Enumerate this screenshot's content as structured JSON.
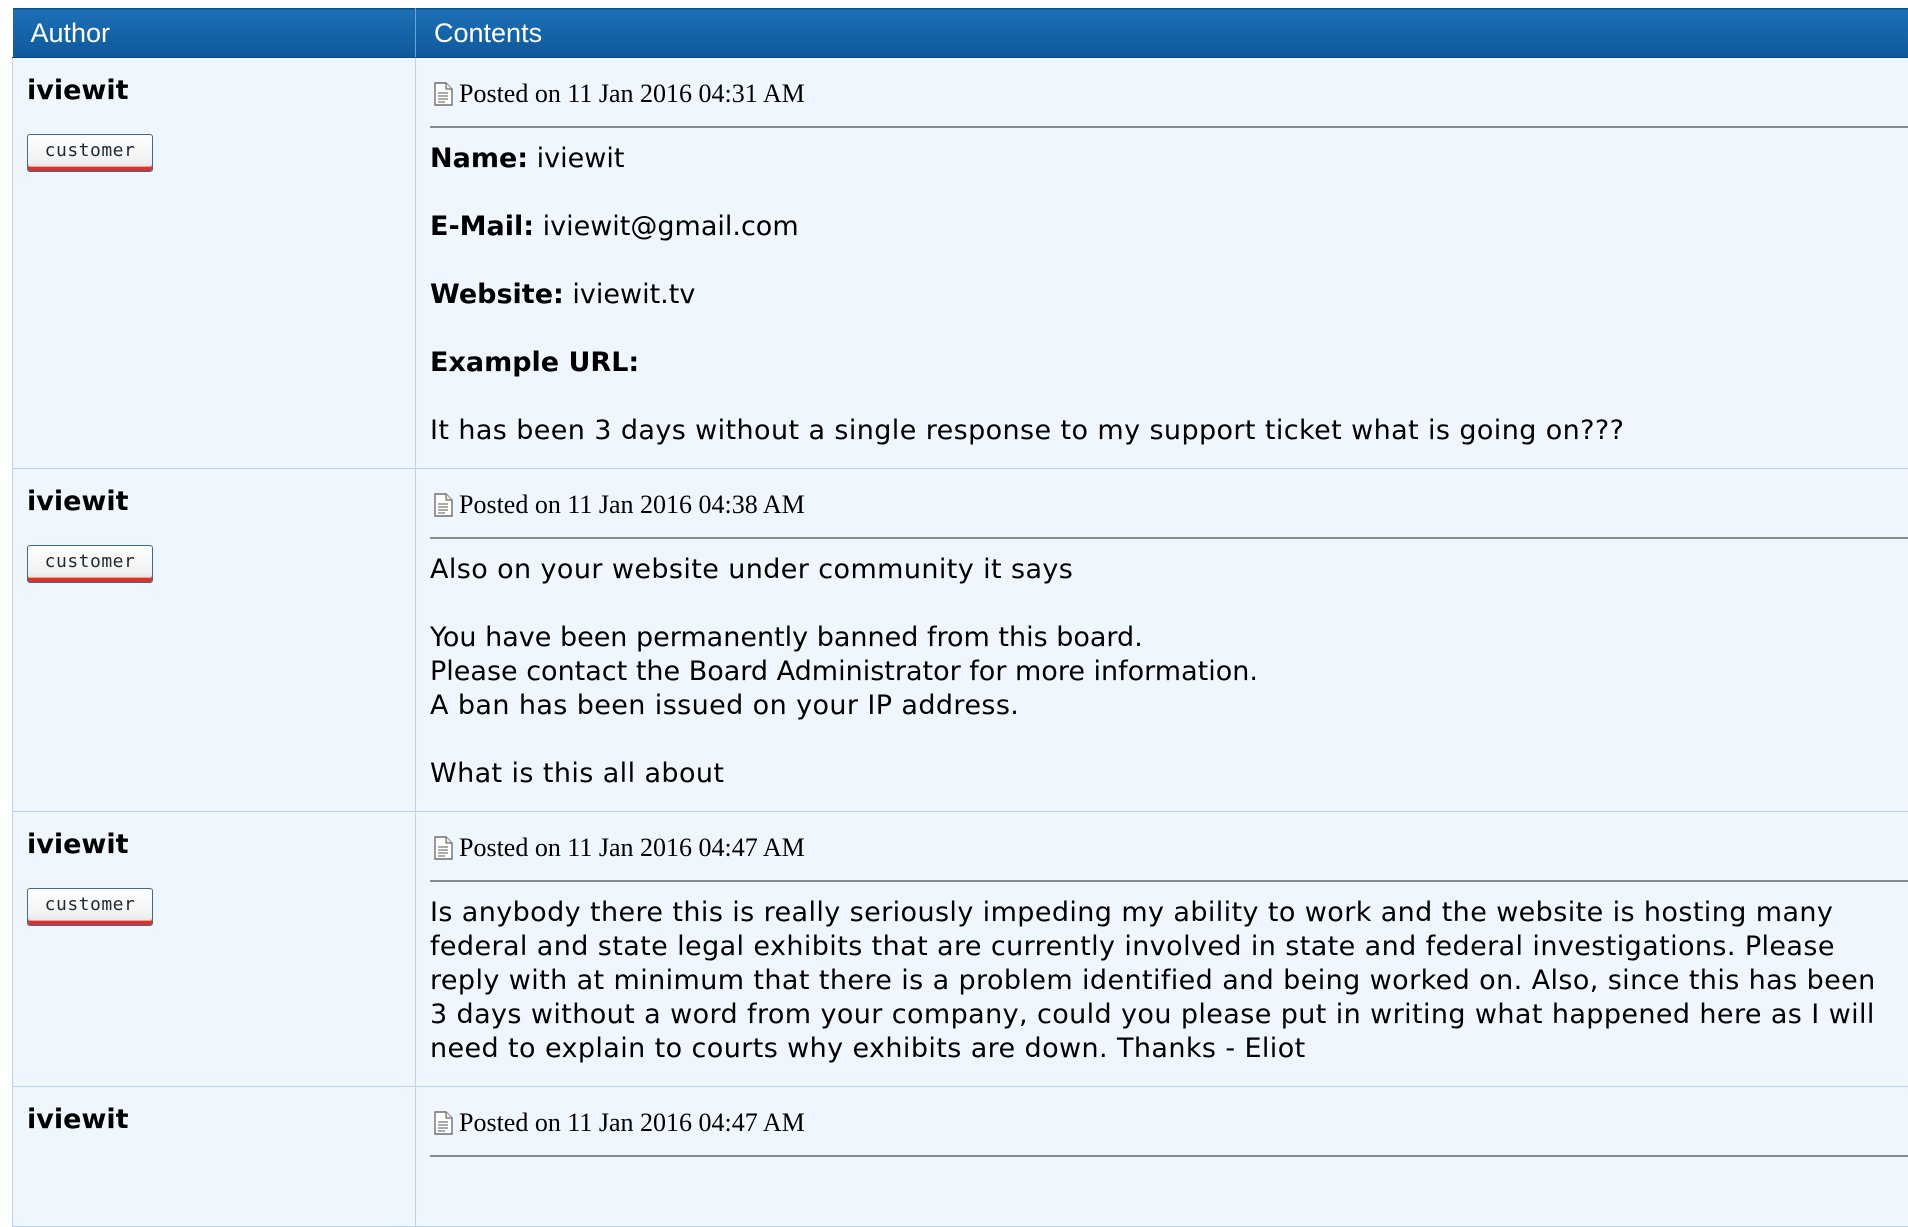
{
  "table": {
    "header_author": "Author",
    "header_contents": "Contents"
  },
  "role_label": "customer",
  "posts": [
    {
      "author": "iviewit",
      "badge": "customer",
      "date": "Posted on 11 Jan 2016 04:31 AM",
      "fields": {
        "name_label": "Name:",
        "name_value": " iviewit",
        "email_label": "E-Mail:",
        "email_value": " iviewit@gmail.com",
        "website_label": "Website:",
        "website_value": " iviewit.tv",
        "example_label": "Example URL:"
      },
      "body": "It has been 3 days without a single response to my support ticket what is going on???"
    },
    {
      "author": "iviewit",
      "badge": "customer",
      "date": "Posted on 11 Jan 2016 04:38 AM",
      "line1": "Also on your website under community it says",
      "line2": "You have been permanently banned from this board.",
      "line3": "Please contact the Board Administrator for more information.",
      "line4": "A ban has been issued on your IP address.",
      "line5": "What is this all about"
    },
    {
      "author": "iviewit",
      "badge": "customer",
      "date": "Posted on 11 Jan 2016 04:47 AM",
      "body": "Is anybody there this is really seriously impeding my ability to work and the website is hosting many federal and state legal exhibits that are currently involved in state and federal investigations. Please reply with at minimum that there is a problem identified and being worked on. Also, since this has been 3 days without a word from your company, could you please put in writing what happened here as I will need to explain to courts why exhibits are down. Thanks - Eliot"
    },
    {
      "author": "iviewit",
      "date": "Posted on 11 Jan 2016 04:47 AM"
    }
  ],
  "colors": {
    "header_bg": "#1462a6",
    "row_bg": "#f0f6fd",
    "border": "#b9d3ec",
    "badge_accent": "#d9342b"
  },
  "icons": {
    "post_icon": "document-icon"
  }
}
